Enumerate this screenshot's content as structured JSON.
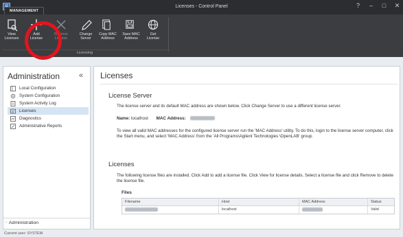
{
  "window": {
    "title": "Licenses - Control Panel",
    "controls": [
      "?",
      "–",
      "□",
      "✕"
    ]
  },
  "ribbon": {
    "tab_label": "MANAGEMENT",
    "group_label": "Licensing",
    "buttons": [
      {
        "label": "View\nLicenses",
        "icon": "view-icon",
        "enabled": true
      },
      {
        "label": "Add\nLicense",
        "icon": "plus-icon",
        "enabled": true
      },
      {
        "label": "Remove\nLicense",
        "icon": "remove-icon",
        "enabled": false
      },
      {
        "label": "Change\nServer",
        "icon": "pencil-icon",
        "enabled": true
      },
      {
        "label": "Copy MAC\nAddress",
        "icon": "copy-icon",
        "enabled": true
      },
      {
        "label": "Save MAC\nAddress",
        "icon": "save-icon",
        "enabled": true
      },
      {
        "label": "Get\nLicense",
        "icon": "globe-icon",
        "enabled": true
      }
    ]
  },
  "sidebar": {
    "title": "Administration",
    "collapse_glyph": "«",
    "items": [
      {
        "label": "Local Configuration",
        "icon": "local-config-icon",
        "active": false
      },
      {
        "label": "System Configuration",
        "icon": "system-config-icon",
        "active": false
      },
      {
        "label": "System Activity Log",
        "icon": "activity-log-icon",
        "active": false
      },
      {
        "label": "Licenses",
        "icon": "licenses-icon",
        "active": true
      },
      {
        "label": "Diagnostics",
        "icon": "diagnostics-icon",
        "active": false
      },
      {
        "label": "Administrative Reports",
        "icon": "reports-icon",
        "active": false
      }
    ],
    "bottom_label": "Administration"
  },
  "main": {
    "title": "Licenses",
    "license_server": {
      "heading": "License Server",
      "intro": "The license server and its default MAC address are shown below. Click Change Server to use a different license server.",
      "name_label": "Name:",
      "name_value": "localhost",
      "mac_label": "MAC Address:",
      "help": "To view all valid MAC addresses for the configured license server run the 'MAC Address' utility. To do this, login to the license server computer, click the Start menu, and select 'MAC Address' from the 'All Programs\\Agilent Technologies \\OpenLAB' group."
    },
    "licenses": {
      "heading": "Licenses",
      "intro": "The following license files are installed. Click Add to add a license file. Click View for license details. Select a license file and click Remove to delete the license file.",
      "files_label": "Files",
      "columns": [
        "Filename",
        "Host",
        "MAC Address",
        "Status"
      ],
      "rows": [
        {
          "host": "localhost",
          "status": "Valid"
        }
      ]
    }
  },
  "statusbar": {
    "text": "Current user: SYSTEM"
  }
}
